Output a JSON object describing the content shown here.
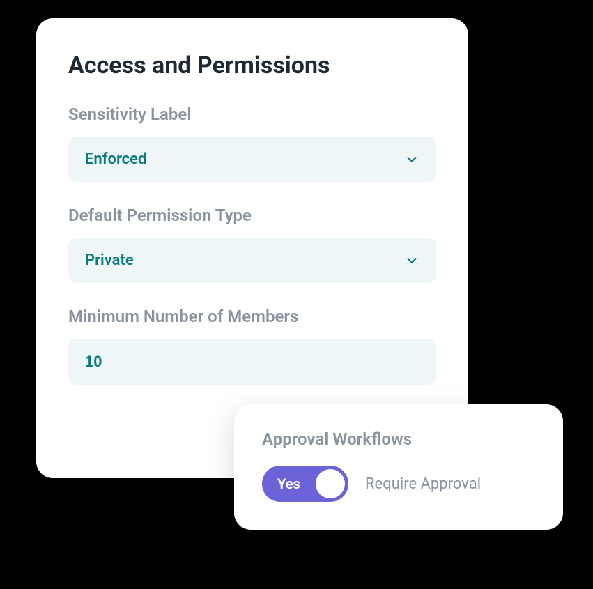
{
  "main": {
    "title": "Access and Permissions",
    "sensitivity": {
      "label": "Sensitivity Label",
      "value": "Enforced"
    },
    "permission_type": {
      "label": "Default Permission Type",
      "value": "Private"
    },
    "min_members": {
      "label": "Minimum Number of Members",
      "value": "10"
    }
  },
  "overlay": {
    "title": "Approval Workflows",
    "toggle": {
      "state_label": "Yes",
      "description": "Require Approval"
    }
  }
}
